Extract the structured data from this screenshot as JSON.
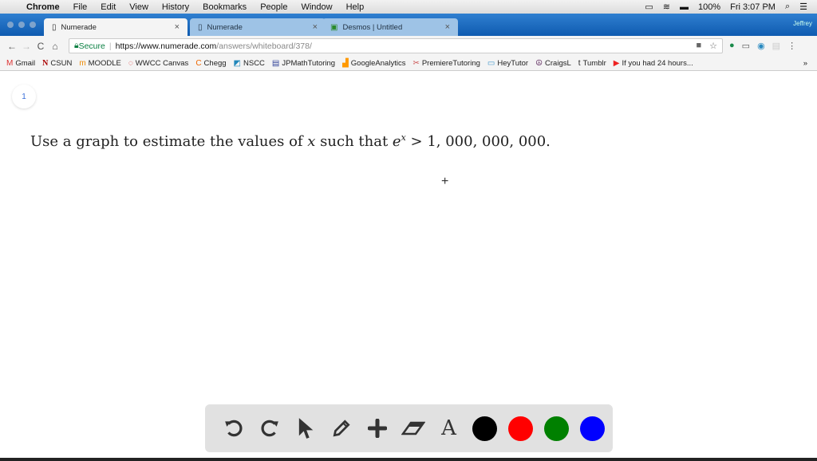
{
  "menubar": {
    "app": "Chrome",
    "items": [
      "File",
      "Edit",
      "View",
      "History",
      "Bookmarks",
      "People",
      "Window",
      "Help"
    ],
    "battery": "100%",
    "clock": "Fri 3:07 PM"
  },
  "tabs": [
    {
      "title": "Numerade",
      "active": true
    },
    {
      "title": "Numerade",
      "active": false
    },
    {
      "title": "Desmos | Untitled",
      "active": false
    }
  ],
  "profile": "Jeffrey",
  "address": {
    "secure": "Secure",
    "host": "https://www.numerade.com",
    "path": "/answers/whiteboard/378/"
  },
  "bookmarks": [
    {
      "label": "Gmail",
      "icon": "M"
    },
    {
      "label": "CSUN",
      "icon": "N"
    },
    {
      "label": "MOODLE",
      "icon": "m"
    },
    {
      "label": "WWCC Canvas",
      "icon": "◌"
    },
    {
      "label": "Chegg",
      "icon": "C"
    },
    {
      "label": "NSCC",
      "icon": "◩"
    },
    {
      "label": "JPMathTutoring",
      "icon": "▤"
    },
    {
      "label": "GoogleAnalytics",
      "icon": "▟"
    },
    {
      "label": "PremiereTutoring",
      "icon": "✂"
    },
    {
      "label": "HeyTutor",
      "icon": "▭"
    },
    {
      "label": "CraigsL",
      "icon": "☮"
    },
    {
      "label": "Tumblr",
      "icon": "t"
    },
    {
      "label": "If you had 24 hours...",
      "icon": "▶"
    }
  ],
  "page": {
    "number": "1",
    "question_pre": "Use a graph to estimate the values of ",
    "var": "x",
    "question_mid": " such that ",
    "base": "e",
    "exp": "x",
    "question_post": " > 1, 000, 000, 000."
  },
  "toolbar": {
    "colors": [
      "#000000",
      "#ff0000",
      "#008000",
      "#0000ff"
    ]
  }
}
